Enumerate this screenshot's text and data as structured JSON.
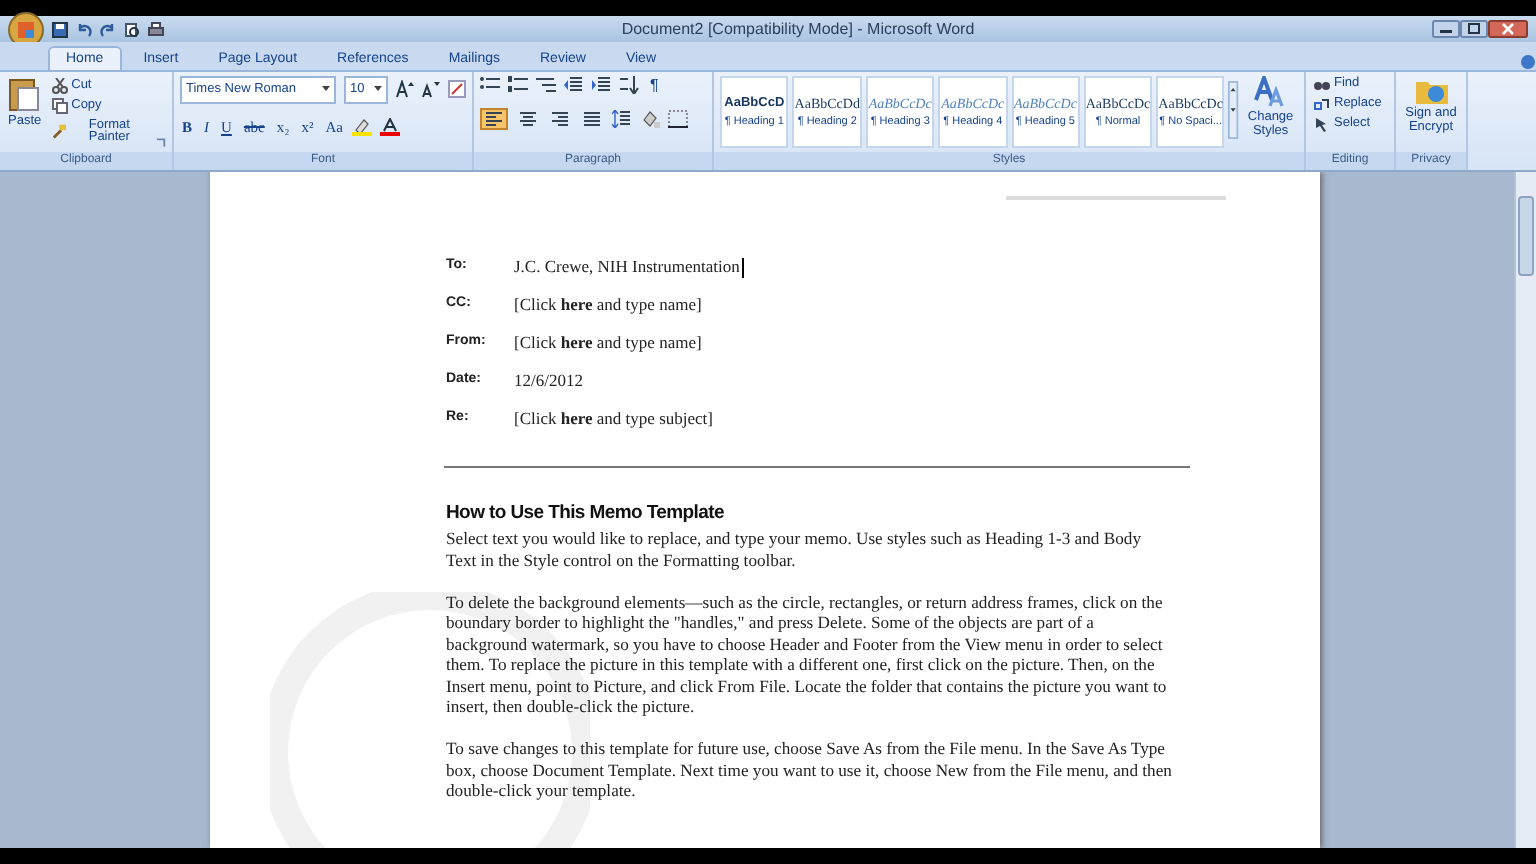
{
  "window": {
    "title": "Document2 [Compatibility Mode] - Microsoft Word"
  },
  "tabs": [
    {
      "label": "Home",
      "selected": true
    },
    {
      "label": "Insert",
      "selected": false
    },
    {
      "label": "Page Layout",
      "selected": false
    },
    {
      "label": "References",
      "selected": false
    },
    {
      "label": "Mailings",
      "selected": false
    },
    {
      "label": "Review",
      "selected": false
    },
    {
      "label": "View",
      "selected": false
    }
  ],
  "ribbon": {
    "clipboard": {
      "label": "Clipboard",
      "paste": "Paste",
      "items": [
        "Cut",
        "Copy",
        "Format Painter"
      ]
    },
    "font": {
      "label": "Font",
      "font_name": "Times New Roman",
      "font_size": "10",
      "format_buttons": [
        "B",
        "I",
        "U",
        "abc",
        "x₂",
        "x²",
        "Aa"
      ]
    },
    "paragraph": {
      "label": "Paragraph",
      "show_marks": "¶",
      "alignments": [
        {
          "kind": "left",
          "selected": true
        },
        {
          "kind": "center",
          "selected": false
        },
        {
          "kind": "right",
          "selected": false
        },
        {
          "kind": "justify",
          "selected": false
        }
      ]
    },
    "styles": {
      "label": "Styles",
      "gallery": [
        {
          "sample": "AaBbCcD",
          "name": "¶ Heading 1",
          "kind": "bold"
        },
        {
          "sample": "AaBbCcDd",
          "name": "¶ Heading 2",
          "kind": "plain"
        },
        {
          "sample": "AaBbCcDc",
          "name": "¶ Heading 3",
          "kind": "italic"
        },
        {
          "sample": "AaBbCcDc",
          "name": "¶ Heading 4",
          "kind": "italic"
        },
        {
          "sample": "AaBbCcDc",
          "name": "¶ Heading 5",
          "kind": "italic"
        },
        {
          "sample": "AaBbCcDc",
          "name": "¶ Normal",
          "kind": "plain"
        },
        {
          "sample": "AaBbCcDc",
          "name": "¶ No Spaci...",
          "kind": "plain"
        }
      ],
      "change_styles": "Change Styles"
    },
    "editing": {
      "label": "Editing",
      "items": [
        "Find",
        "Replace",
        "Select"
      ]
    },
    "privacy": {
      "label": "Privacy",
      "button": "Sign and Encrypt"
    }
  },
  "memo": {
    "fields": [
      {
        "label": "To:",
        "value": "J.C. Crewe, NIH Instrumentation",
        "has_cursor": true
      },
      {
        "label": "CC:",
        "value": "[Click **here** and type name]",
        "has_cursor": false
      },
      {
        "label": "From:",
        "value": "[Click **here** and type name]",
        "has_cursor": false
      },
      {
        "label": "Date:",
        "value": "12/6/2012",
        "has_cursor": false
      },
      {
        "label": "Re:",
        "value": "[Click **here** and type subject]",
        "has_cursor": false
      }
    ],
    "heading": "How to Use This Memo Template",
    "paragraphs": [
      "Select text you would like to replace, and type your memo. Use styles such as Heading 1-3 and Body Text in the Style control on the Formatting toolbar.",
      "To delete the background elements—such as the circle, rectangles, or return address frames, click on the boundary border to highlight the \"handles,\" and press Delete. Some of the objects are part of a background watermark, so you have to choose Header and Footer from the View menu in order to select them. To replace the picture in this template with a different one, first click on the picture. Then, on the Insert menu, point to Picture, and click From File. Locate the folder that contains the picture you want to insert, then double-click the picture.",
      "To save changes to this template for future use, choose Save As from the File menu. In the Save As Type box, choose Document Template. Next time you want to use it, choose New from the File menu, and then double-click your template."
    ]
  }
}
